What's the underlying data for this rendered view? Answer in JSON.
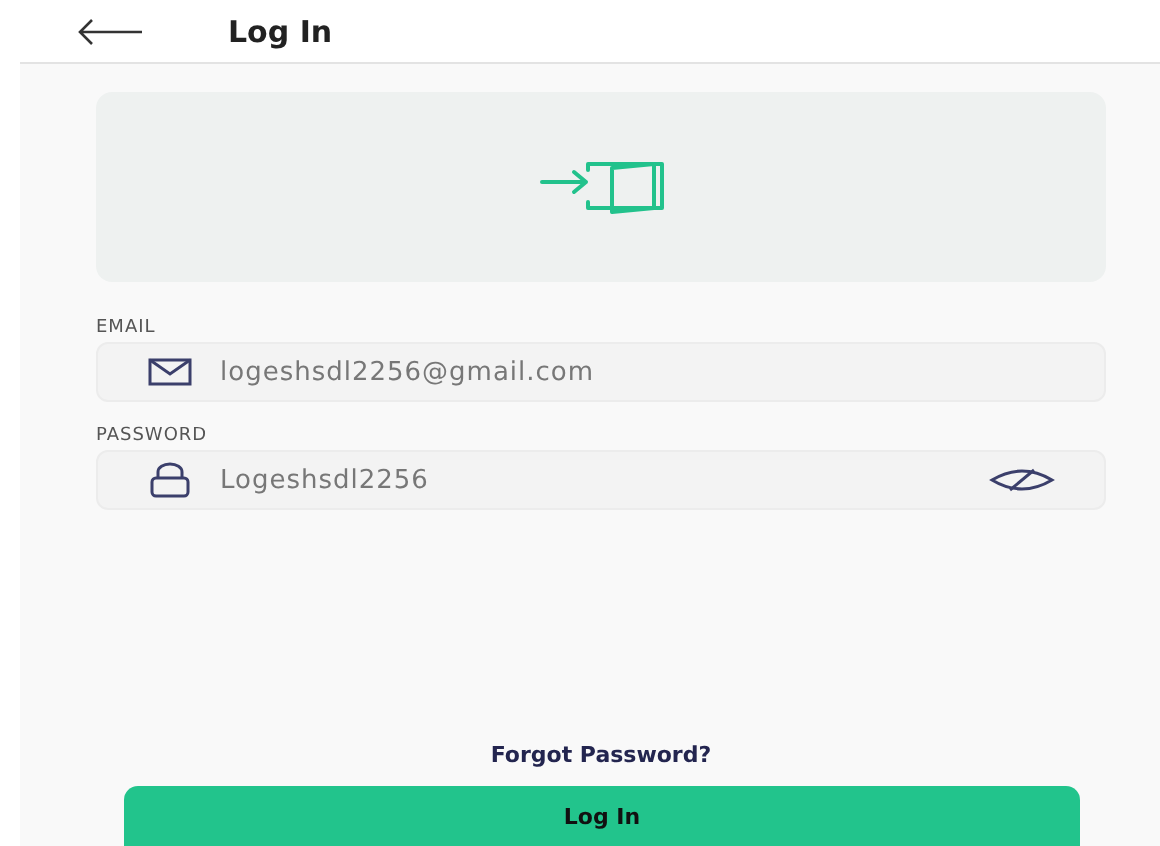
{
  "header": {
    "title": "Log In"
  },
  "fields": [
    {
      "label": "EMAIL",
      "value": "logeshsdl2256@gmail.com",
      "kind": "email"
    },
    {
      "label": "PASSWORD",
      "value": "Logeshsdl2256",
      "kind": "password"
    }
  ],
  "forgot_link": "Forgot Password?",
  "submit_button": "Log In"
}
